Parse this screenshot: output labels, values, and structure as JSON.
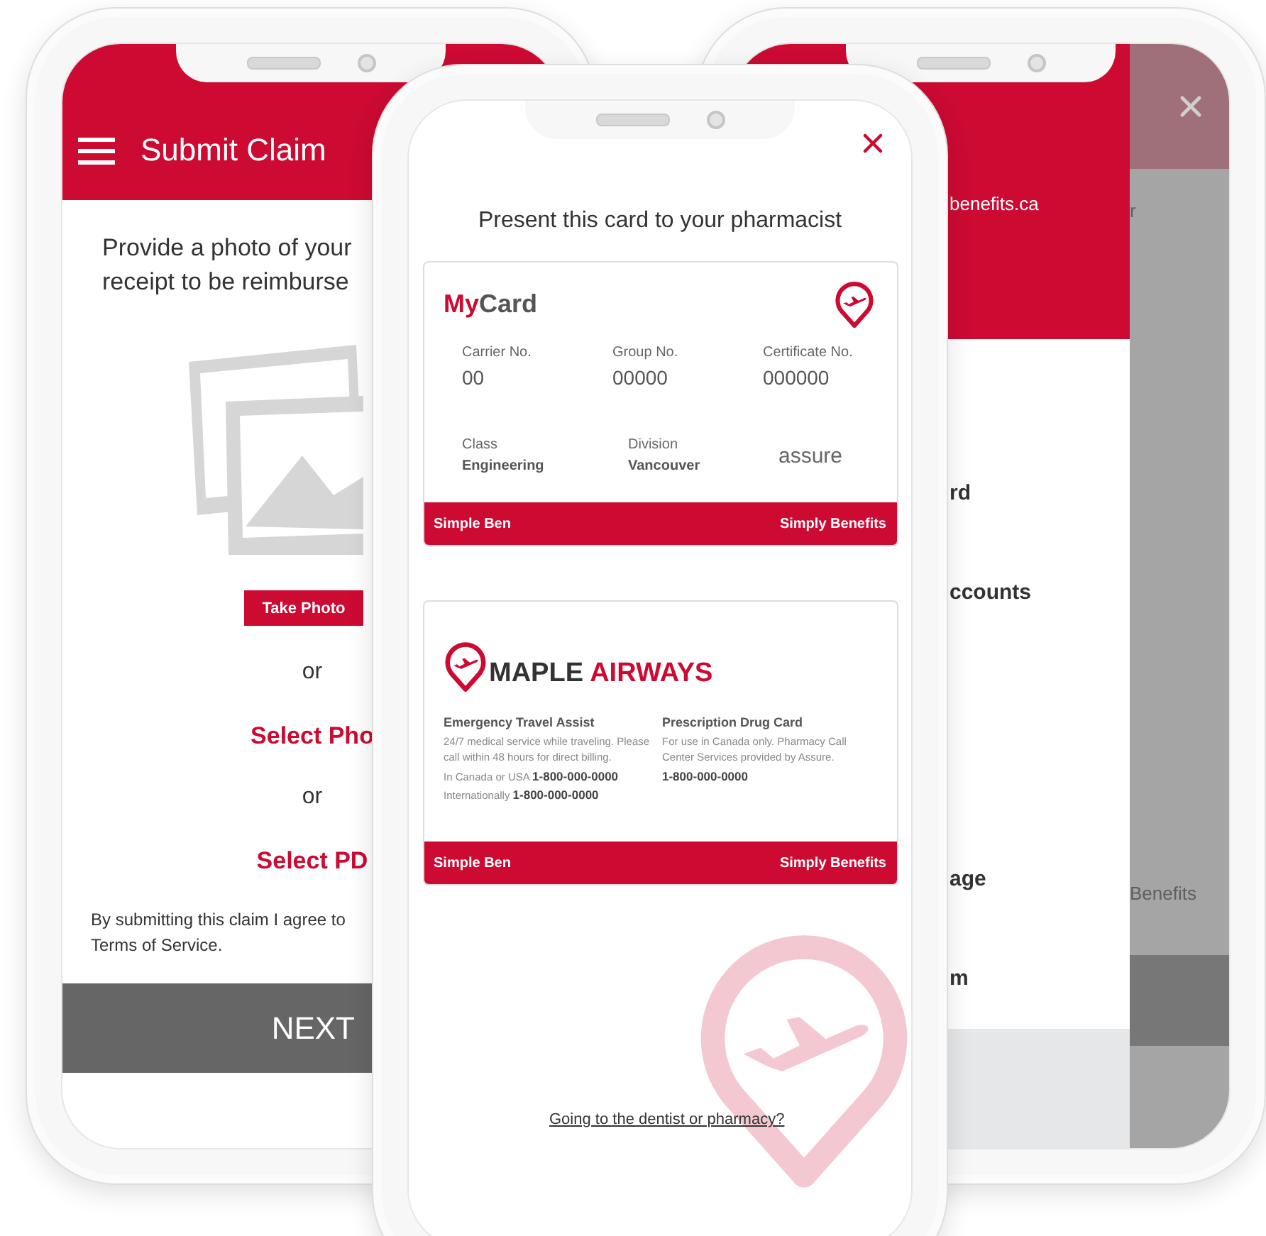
{
  "claim_screen": {
    "title": "Submit Claim",
    "instructions": [
      "Provide a photo of your",
      "receipt to be reimburse"
    ],
    "take_photo_button": "Take Photo",
    "options": [
      {
        "kind": "separator",
        "text": "or"
      },
      {
        "kind": "link",
        "text": "Select Pho"
      },
      {
        "kind": "separator",
        "text": "or"
      },
      {
        "kind": "link",
        "text": "Select PD"
      }
    ],
    "terms": [
      "By submitting this claim I agree to",
      "Terms of Service."
    ],
    "next_button": "NEXT"
  },
  "card_screen": {
    "title": "Present this card to your pharmacist",
    "member_card": {
      "brand_accent": "My",
      "brand_rest": "Card",
      "primary_fields": [
        {
          "label": "Carrier No.",
          "value": "00"
        },
        {
          "label": "Group No.",
          "value": "00000"
        },
        {
          "label": "Certificate No.",
          "value": "000000"
        }
      ],
      "secondary_fields": [
        {
          "label": "Class",
          "value": "Engineering"
        },
        {
          "label": "Division",
          "value": "Vancouver"
        }
      ],
      "insurer_logo": "assure",
      "footer_left": "Simple Ben",
      "footer_right": "Simply Benefits"
    },
    "airline_card": {
      "brand_first": "MAPLE",
      "brand_second": "AIRWAYS",
      "sections": [
        {
          "title": "Emergency Travel Assist",
          "text": "24/7 medical service while traveling. Please call within 48 hours for direct billing.",
          "phones": [
            "In Canada or USA **1-800-000-0000**",
            "Internationally **1-800-000-0000**"
          ]
        },
        {
          "title": "Prescription Drug Card",
          "text": "For use in Canada only. Pharmacy Call Center Services provided by Assure.",
          "phones": [
            "**1-800-000-0000**"
          ]
        }
      ],
      "footer_left": "Simple Ben",
      "footer_right": "Simply Benefits"
    },
    "help_link": "Going to the dentist or pharmacy?"
  },
  "menu_screen": {
    "header_text": "benefits.ca",
    "items_top": [
      "rd",
      "ccounts"
    ],
    "items_bottom": [
      "age",
      "m"
    ],
    "overlay_texts": [
      {
        "kind": "top",
        "text": "r"
      },
      {
        "kind": "bottom",
        "text": "Benefits"
      }
    ]
  }
}
